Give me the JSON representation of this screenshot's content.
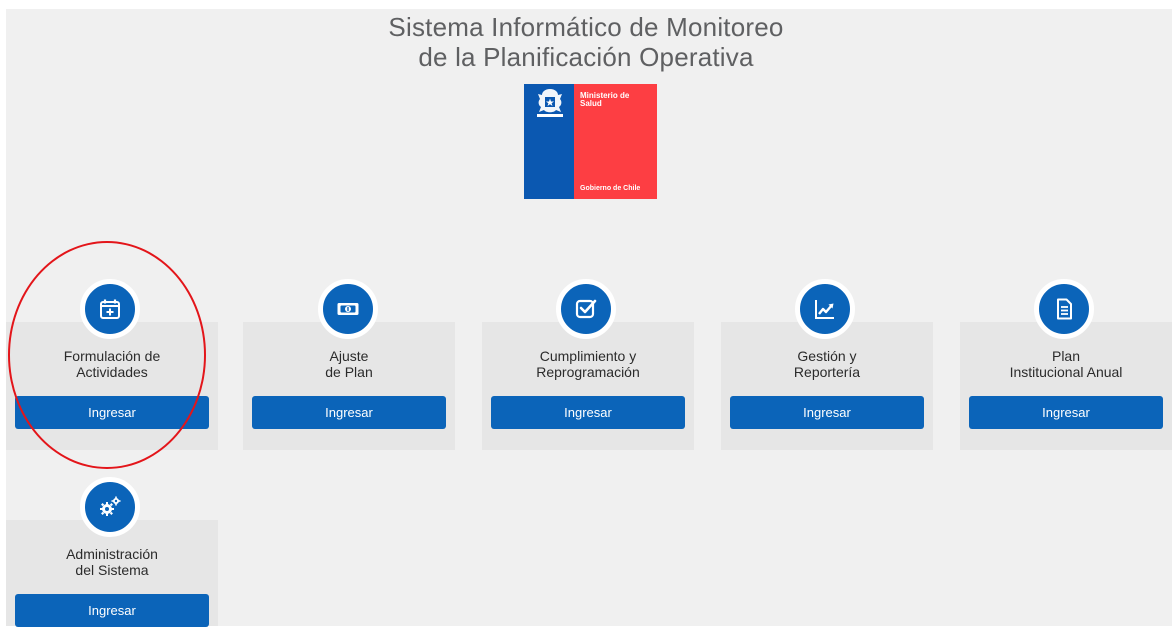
{
  "header": {
    "title_line1": "Sistema Informático de Monitoreo",
    "title_line2": "de la Planificación Operativa"
  },
  "logo": {
    "ministry_line1": "Ministerio de",
    "ministry_line2": "Salud",
    "government": "Gobierno de Chile",
    "colors": {
      "blue": "#0b58b1",
      "red": "#fd3e43"
    }
  },
  "modules": [
    {
      "label": "Formulación de\nActividades",
      "button": "Ingresar",
      "icon": "calendar-add-icon"
    },
    {
      "label": "Ajuste\nde Plan",
      "button": "Ingresar",
      "icon": "money-icon"
    },
    {
      "label": "Cumplimiento y\nReprogramación",
      "button": "Ingresar",
      "icon": "checkbox-icon"
    },
    {
      "label": "Gestión y\nReportería",
      "button": "Ingresar",
      "icon": "trend-chart-icon"
    },
    {
      "label": "Plan\nInstitucional Anual",
      "button": "Ingresar",
      "icon": "document-icon"
    },
    {
      "label": "Administración\ndel Sistema",
      "button": "Ingresar",
      "icon": "gears-icon"
    }
  ],
  "theme": {
    "accent": "#0b64b9",
    "background": "#f0f0f0",
    "card": "#e6e6e6",
    "highlight": "#e3151a"
  }
}
